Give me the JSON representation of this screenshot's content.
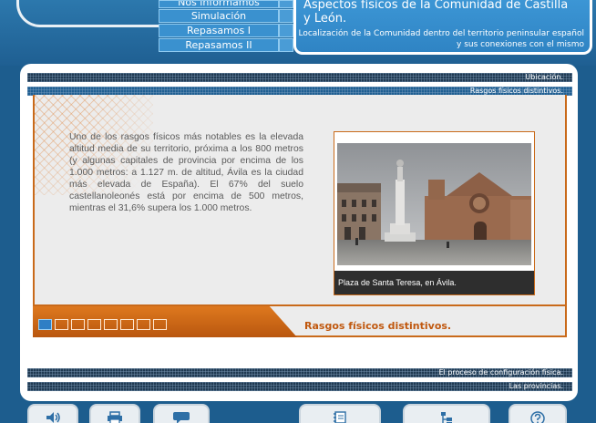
{
  "nav": {
    "items": [
      {
        "label": "Nos informamos"
      },
      {
        "label": "Simulación"
      },
      {
        "label": "Repasamos I"
      },
      {
        "label": "Repasamos II"
      }
    ]
  },
  "header": {
    "title": "Aspectos físicos de la Comunidad de Castilla y León.",
    "subtitle_line1": "Localización de la Comunidad dentro del territorio peninsular español",
    "subtitle_line2": "y sus conexiones con el mismo"
  },
  "sections": {
    "top": [
      {
        "label": "Ubicación."
      },
      {
        "label": "Rasgos físicos distintivos."
      }
    ],
    "bottom": [
      {
        "label": "El proceso de configuración física."
      },
      {
        "label": "Las provincias."
      }
    ]
  },
  "content": {
    "body": "Uno de los rasgos físicos más notables es la elevada altitud media de su territorio, próxima a los 800 metros (y algunas capitales de provincia por encima de los 1.000 metros: a 1.127 m. de altitud, Ávila es la ciudad más elevada de España). El 67% del suelo castellanoleonés está por encima de 500 metros, mientras el 31,6% supera los 1.000 metros.",
    "photo_caption": "Plaza de Santa Teresa, en Ávila."
  },
  "band": {
    "title": "Rasgos físicos distintivos.",
    "pages": 8,
    "active_page": 1
  },
  "toolbar": {
    "buttons": [
      {
        "icon": "speaker-icon"
      },
      {
        "icon": "print-icon"
      },
      {
        "icon": "speech-bubble-icon"
      },
      {
        "icon": "notebook-icon"
      },
      {
        "icon": "tree-outline-icon"
      },
      {
        "icon": "help-icon"
      }
    ]
  },
  "colors": {
    "background": "#1d5d8e",
    "accent_orange": "#c96a1a",
    "header_blue": "#3d97d6"
  }
}
